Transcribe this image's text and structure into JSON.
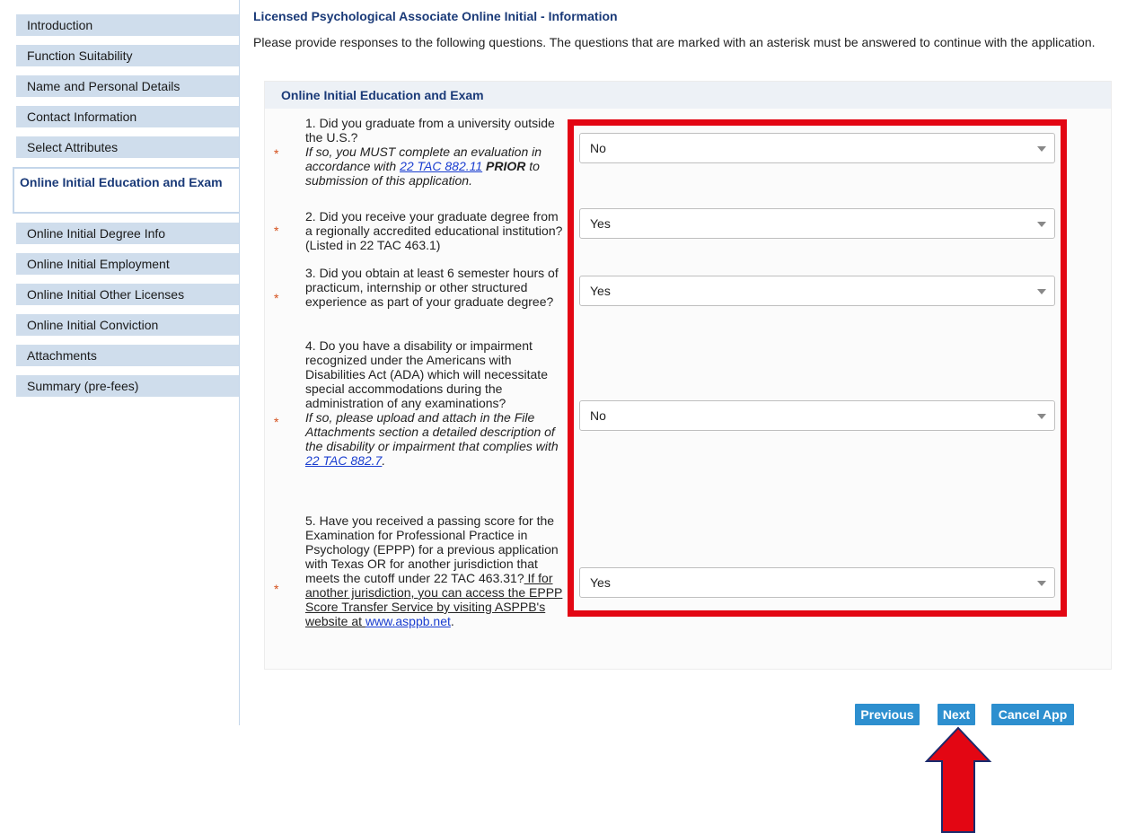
{
  "sidebar": {
    "items": [
      {
        "label": "Introduction"
      },
      {
        "label": "Function Suitability"
      },
      {
        "label": "Name and Personal Details"
      },
      {
        "label": "Contact Information"
      },
      {
        "label": "Select Attributes"
      },
      {
        "label": "Online Initial Education and Exam",
        "active": true
      },
      {
        "label": "Online Initial Degree Info"
      },
      {
        "label": "Online Initial Employment"
      },
      {
        "label": "Online Initial Other Licenses"
      },
      {
        "label": "Online Initial Conviction"
      },
      {
        "label": "Attachments"
      },
      {
        "label": "Summary (pre-fees)"
      }
    ]
  },
  "page": {
    "title": "Licensed Psychological Associate Online Initial - Information",
    "instructions": "Please provide responses to the following questions. The questions that are marked with an asterisk must be answered to continue with the application."
  },
  "section": {
    "title": "Online Initial Education and Exam",
    "required_marker": "*",
    "questions": [
      {
        "text": "1. Did you graduate from a university outside the U.S.?",
        "note_pre": "If so, you MUST complete an evaluation in accordance with ",
        "note_link": "22 TAC 882.11",
        "note_bold": " PRIOR",
        "note_post": " to submission of this application.",
        "answer": "No"
      },
      {
        "text": "2. Did you receive your graduate degree from a regionally accredited educational institution? (Listed in 22 TAC 463.1)",
        "answer": "Yes"
      },
      {
        "text": "3. Did you obtain at least 6 semester hours of practicum, internship or other structured experience as part of your graduate degree?",
        "answer": "Yes"
      },
      {
        "text": "4. Do you have a disability or impairment recognized under the Americans with Disabilities Act (ADA) which will necessitate special accommodations during the administration of any examinations?",
        "note_pre": "If so, please upload and attach in the File Attachments section a detailed description of the disability or impairment that complies with ",
        "note_link": "22 TAC 882.7",
        "note_post": ".",
        "answer": "No"
      },
      {
        "text": "5. Have you received a passing score for the Examination for Professional Practice in Psychology (EPPP) for a previous application with Texas OR for another jurisdiction that meets the cutoff under 22 TAC 463.31?",
        "underlined": " If for another jurisdiction, you can access the EPPP Score Transfer Service by visiting ASPPB's website at ",
        "link": "www.asppb.net",
        "post": ".",
        "answer": "Yes"
      }
    ]
  },
  "buttons": {
    "previous": "Previous",
    "next": "Next",
    "cancel": "Cancel App"
  },
  "colors": {
    "highlight": "#e30613",
    "button": "#2d8fcf",
    "heading": "#1a3a78",
    "sidebar": "#cfddec"
  }
}
